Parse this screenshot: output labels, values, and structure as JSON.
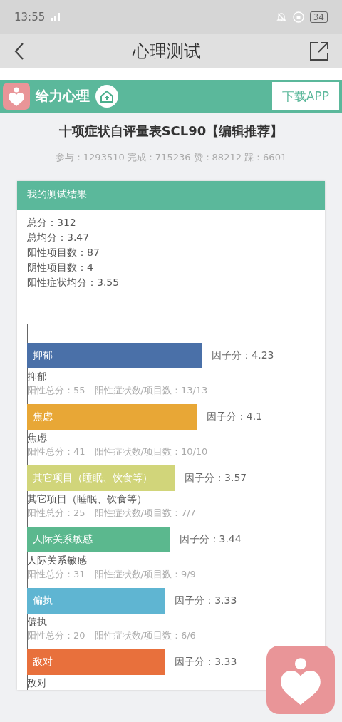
{
  "status_bar": {
    "time": "13:55",
    "battery": "34"
  },
  "nav": {
    "title": "心理测试"
  },
  "banner": {
    "brand": "给力心理",
    "download": "下载APP"
  },
  "test": {
    "title": "十项症状自评量表SCL90【编辑推荐】",
    "stats": "参与：1293510 完成：715236 赞：88212 踩：6601"
  },
  "result": {
    "header": "我的测试结果",
    "summary": [
      "总分：312",
      "总均分：3.47",
      "阳性项目数：87",
      "阴性项目数：4",
      "阳性症状均分：3.55"
    ],
    "factors": [
      {
        "name": "抑郁",
        "bar_label": "抑郁",
        "score": "因子分：4.23",
        "level": 0.846,
        "color": "#4a70a8",
        "detail": "阳性总分：55　阳性症状数/项目数：13/13"
      },
      {
        "name": "焦虑",
        "bar_label": "焦虑",
        "score": "因子分：4.1",
        "level": 0.82,
        "color": "#e8a736",
        "detail": "阳性总分：41　阳性症状数/项目数：10/10"
      },
      {
        "name": "其它项目（睡眠、饮食等）",
        "bar_label": "其它项目（睡眠、饮食等）",
        "score": "因子分：3.57",
        "level": 0.714,
        "color": "#d1d57a",
        "detail": "阳性总分：25　阳性症状数/项目数：7/7"
      },
      {
        "name": "人际关系敏感",
        "bar_label": "人际关系敏感",
        "score": "因子分：3.44",
        "level": 0.688,
        "color": "#5bb88e",
        "detail": "阳性总分：31　阳性症状数/项目数：9/9"
      },
      {
        "name": "偏执",
        "bar_label": "偏执",
        "score": "因子分：3.33",
        "level": 0.666,
        "color": "#5fb5d2",
        "detail": "阳性总分：20　阳性症状数/项目数：6/6"
      },
      {
        "name": "敌对",
        "bar_label": "敌对",
        "score": "因子分：3.33",
        "level": 0.666,
        "color": "#e8703c"
      }
    ]
  }
}
